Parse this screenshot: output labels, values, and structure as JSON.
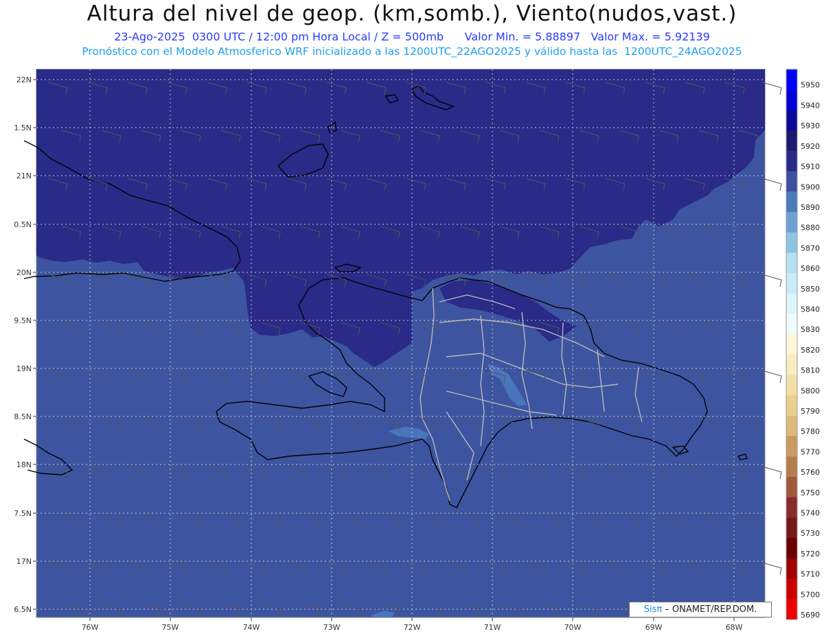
{
  "header": {
    "title": "Altura del nivel de geop. (km,somb.), Viento(nudos,vast.)",
    "line1_left": "23-Ago-2025  0300 UTC / 12:00 pm Hora Local / Z = 500mb",
    "line1_right": "Valor Min. = 5.88897   Valor Max. = 5.92139",
    "line2": "Pronóstico con el Modelo Atmosferico WRF inicializado a las 1200UTC_22AGO2025 y válido hasta las  1200UTC_24AGO2025"
  },
  "axes": {
    "lat_labels": [
      "22N",
      "1.5N",
      "21N",
      "0.5N",
      "20N",
      "9.5N",
      "19N",
      "8.5N",
      "18N",
      "7.5N",
      "17N",
      "6.5N"
    ],
    "lon_labels": [
      "76W",
      "75W",
      "74W",
      "73W",
      "72W",
      "71W",
      "70W",
      "69W",
      "68W"
    ]
  },
  "colorbar": {
    "levels": [
      5950,
      5940,
      5930,
      5920,
      5910,
      5900,
      5890,
      5880,
      5870,
      5860,
      5850,
      5840,
      5830,
      5820,
      5810,
      5800,
      5790,
      5780,
      5770,
      5760,
      5750,
      5740,
      5730,
      5720,
      5710,
      5700,
      5690
    ],
    "colors": [
      "#0000ff",
      "#0000d8",
      "#0a0a9a",
      "#1a1a70",
      "#2a2a88",
      "#3c50a0",
      "#4a7cbc",
      "#6ea0d4",
      "#8cc4e4",
      "#b4e0f0",
      "#c8ecf6",
      "#dcf4fa",
      "#f0fbfd",
      "#fdf6d8",
      "#f8ecc0",
      "#f2dfa6",
      "#ead08c",
      "#ddb97a",
      "#c99a62",
      "#b57e4e",
      "#a15a3c",
      "#8a2c2c",
      "#741a1a",
      "#6a0000",
      "#a00000",
      "#cc0000",
      "#ee0000"
    ]
  },
  "colors": {
    "ocean_high": "#2a2a88",
    "ocean_low": "#3d55a0",
    "patch": "#4a74bc"
  },
  "credit": {
    "brand": "Sisπ",
    "text": " – ONAMET/REP.DOM."
  }
}
